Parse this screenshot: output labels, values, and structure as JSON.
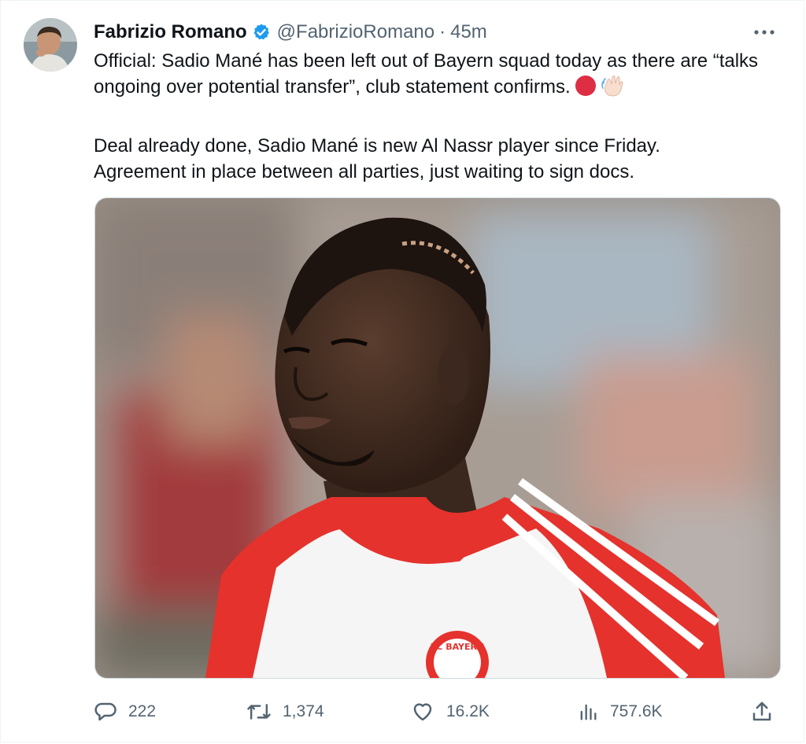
{
  "author": {
    "display_name": "Fabrizio Romano",
    "handle": "@FabrizioRomano",
    "separator": "·",
    "time": "45m",
    "verified": true
  },
  "tweet": {
    "paragraph_1": "Official: Sadio Mané has been left out of Bayern squad today as there are “talks ongoing over potential transfer”, club statement confirms.",
    "paragraph_2": "Deal already done, Sadio Mané is new Al Nassr player since Friday.",
    "paragraph_3": "Agreement in place between all parties, just waiting to sign docs."
  },
  "media": {
    "jersey_text": "FC BAYERN"
  },
  "metrics": {
    "replies": "222",
    "reposts": "1,374",
    "likes": "16.2K",
    "views": "757.6K"
  },
  "icons": {
    "verified": "verified-badge-icon",
    "more": "more-dots-icon",
    "reply": "reply-icon",
    "repost": "repost-icon",
    "like": "heart-icon",
    "views": "views-chart-icon",
    "share": "share-icon",
    "emoji_1": "red-circle-icon",
    "emoji_2": "waving-hand-icon"
  },
  "colors": {
    "verified_blue": "#1d9bf0",
    "muted_text": "#536471",
    "text": "#0f1419"
  }
}
